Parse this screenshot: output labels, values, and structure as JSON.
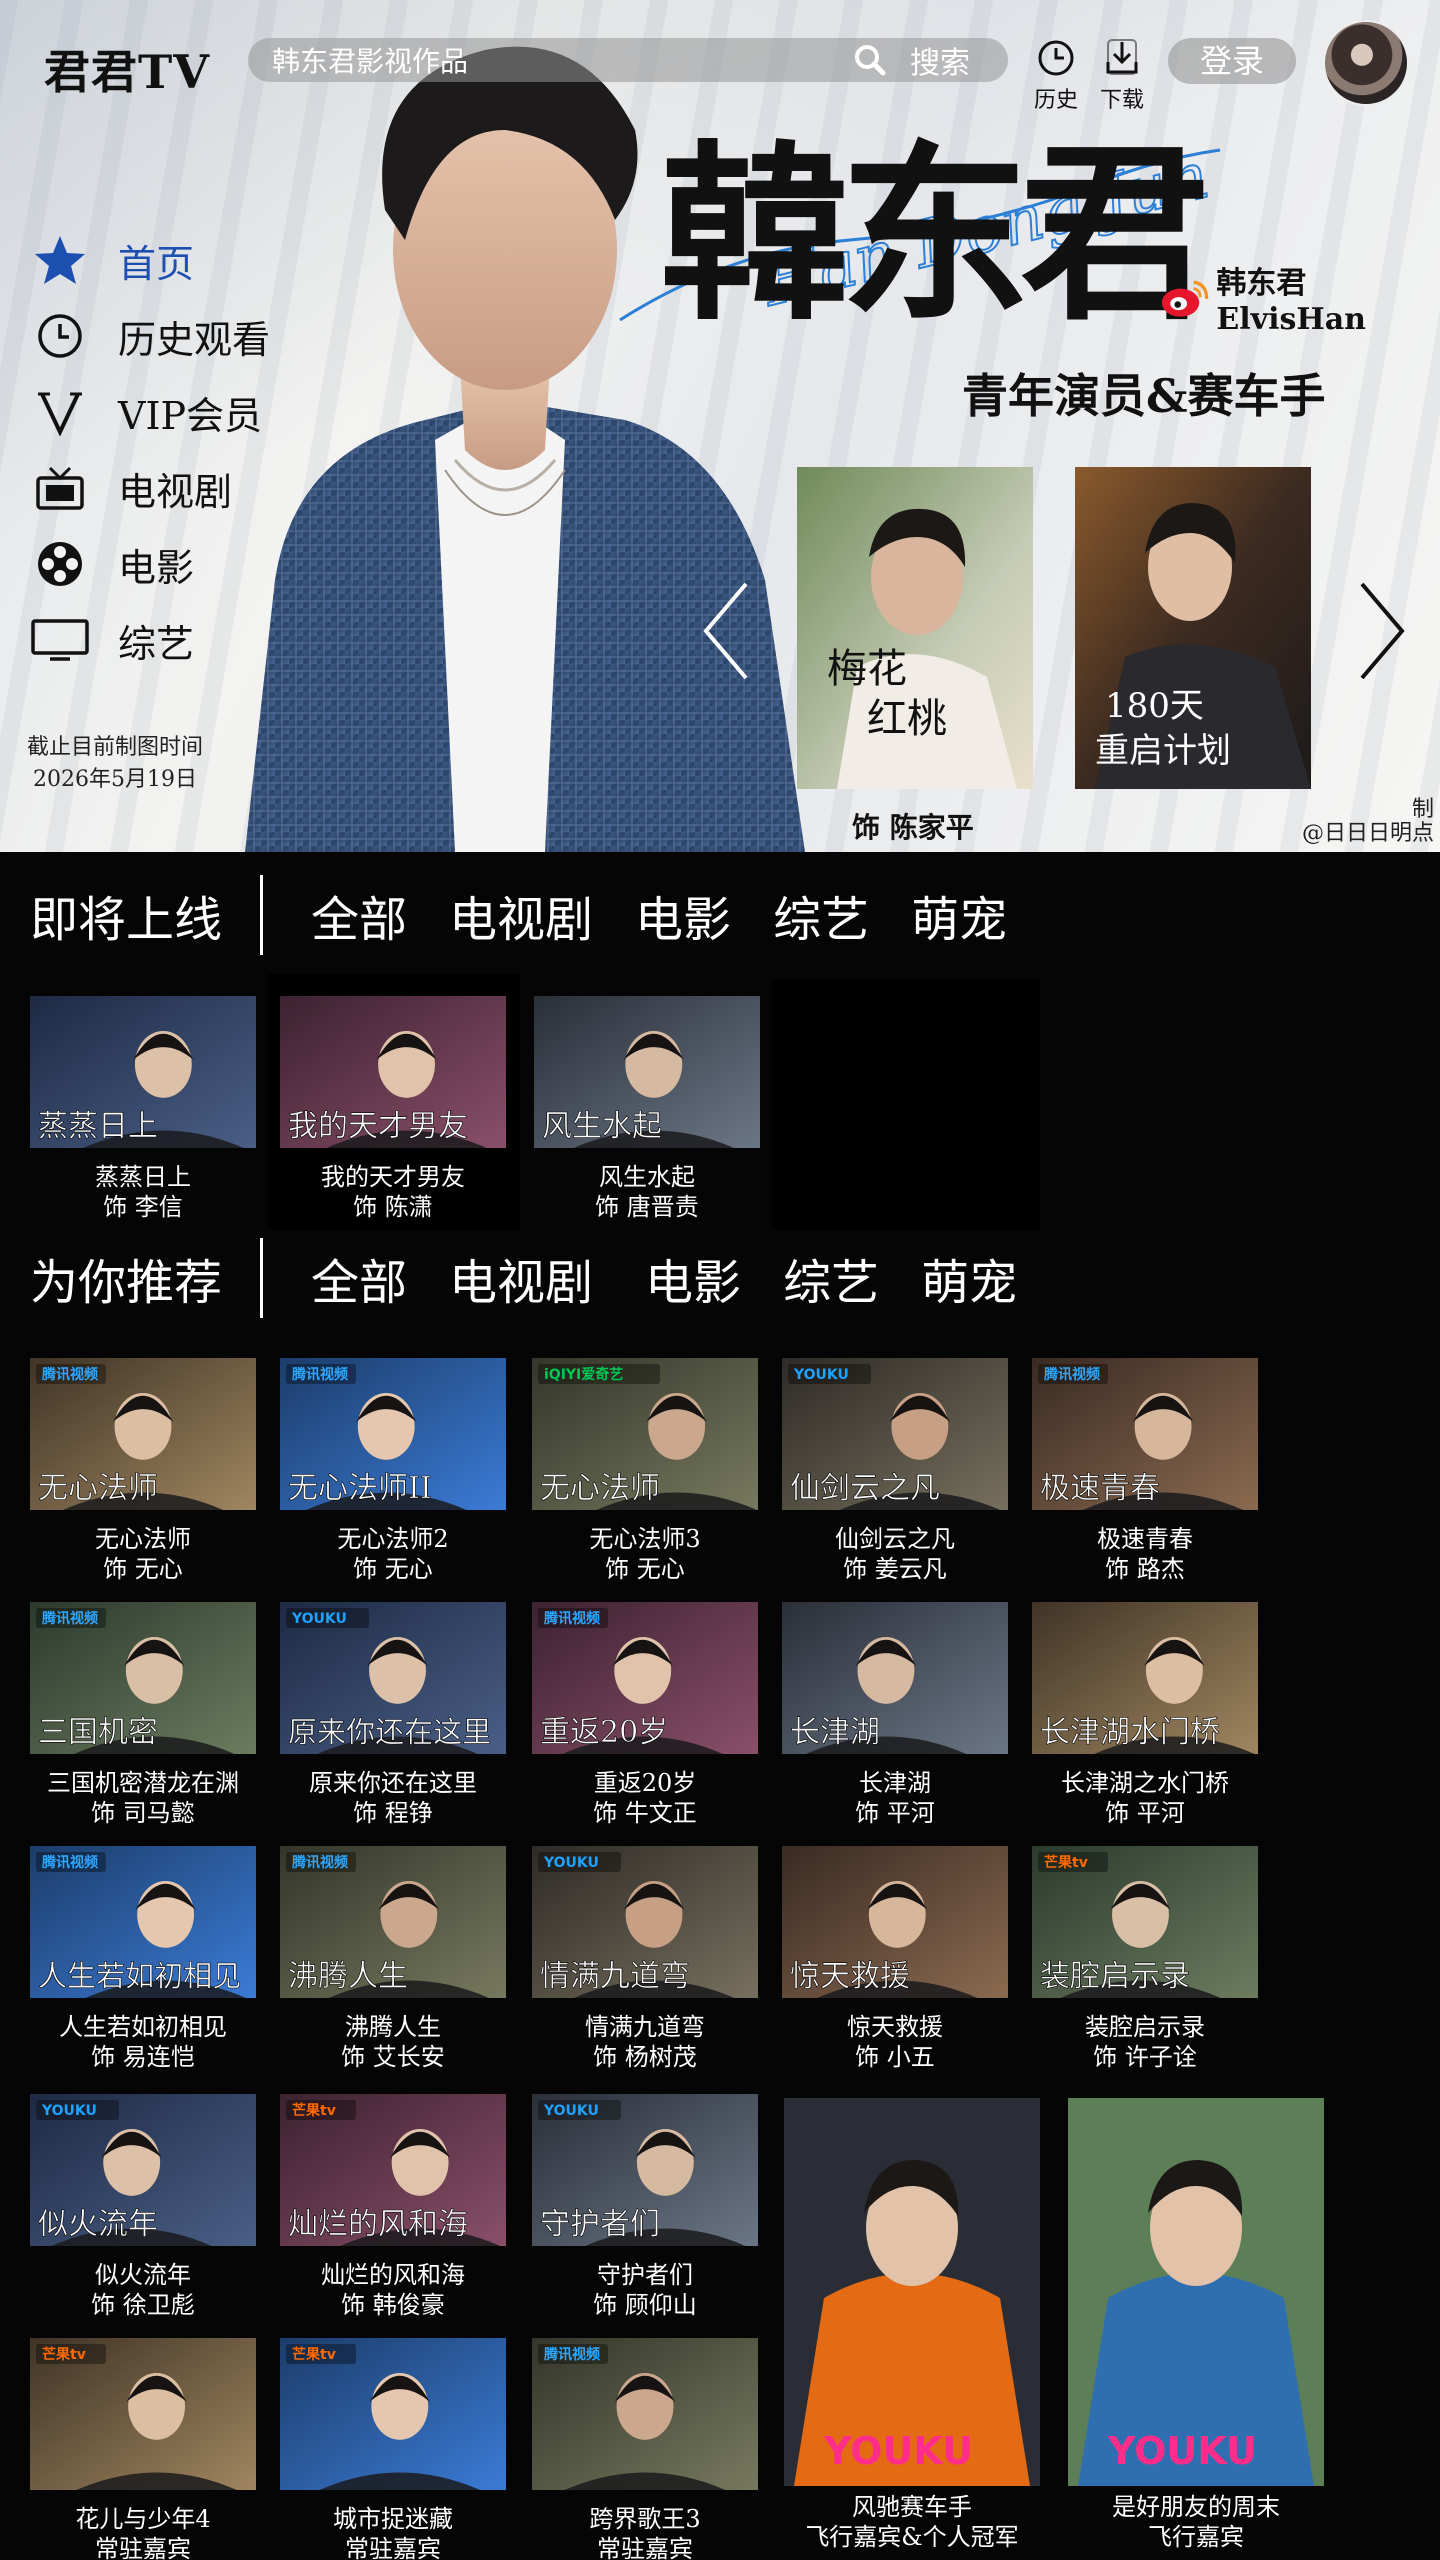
{
  "header": {
    "logo": "君君TV",
    "search_placeholder": "韩东君影视作品",
    "search_button": "搜索",
    "history_label": "历史",
    "download_label": "下载",
    "login_button": "登录"
  },
  "sidebar": {
    "items": [
      {
        "label": "首页",
        "icon": "star-icon"
      },
      {
        "label": "历史观看",
        "icon": "clock-icon"
      },
      {
        "label": "VIP会员",
        "icon": "vip-icon"
      },
      {
        "label": "电视剧",
        "icon": "tv-icon"
      },
      {
        "label": "电影",
        "icon": "film-reel-icon"
      },
      {
        "label": "综艺",
        "icon": "monitor-icon"
      }
    ],
    "as_of_line1": "截止目前制图时间",
    "as_of_line2": "2026年5月19日"
  },
  "hero": {
    "title": "韓东君",
    "script_text": "Han Dong Jun",
    "weibo_name": "韩东君ElvisHan",
    "subtitle": "青年演员&赛车手",
    "posters": [
      {
        "title": "梅花红桃",
        "caption": "饰 陈家平"
      },
      {
        "title": "180天重启计划",
        "caption": ""
      }
    ],
    "weibo_mark_line1": "@日日日明点",
    "weibo_mark_line2": "制"
  },
  "upcoming": {
    "title": "即将上线",
    "tabs": [
      "全部",
      "电视剧",
      "电影",
      "综艺",
      "萌宠"
    ],
    "items": [
      {
        "name": "蒸蒸日上",
        "role": "饰  李信",
        "overlay": "蒸蒸日上"
      },
      {
        "name": "我的天才男友",
        "role": "饰 陈潇",
        "overlay": "我的天才男友"
      },
      {
        "name": "风生水起",
        "role": "饰  唐晋责",
        "overlay": "风生水起"
      }
    ]
  },
  "recommend": {
    "title": "为你推荐",
    "tabs": [
      "全部",
      "电视剧",
      "电影",
      "综艺",
      "萌宠"
    ],
    "rows": [
      [
        {
          "name": "无心法师",
          "role": "饰  无心",
          "platform": "腾讯视频",
          "overlay": "无心法师"
        },
        {
          "name": "无心法师2",
          "role": "饰  无心",
          "platform": "腾讯视频",
          "overlay": "无心法师II"
        },
        {
          "name": "无心法师3",
          "role": "饰  无心",
          "platform": "iQIYI爱奇艺",
          "overlay": "无心法师"
        },
        {
          "name": "仙剑云之凡",
          "role": "饰  姜云凡",
          "platform": "YOUKU",
          "overlay": "仙剑云之凡"
        },
        {
          "name": "极速青春",
          "role": "饰  路杰",
          "platform": "腾讯视频",
          "overlay": "极速青春"
        }
      ],
      [
        {
          "name": "三国机密潜龙在渊",
          "role": "饰  司马懿",
          "platform": "腾讯视频",
          "overlay": "三国机密"
        },
        {
          "name": "原来你还在这里",
          "role": "饰  程铮",
          "platform": "YOUKU",
          "overlay": "原来你还在这里"
        },
        {
          "name": "重返20岁",
          "role": "饰  牛文正",
          "platform": "腾讯视频",
          "overlay": "重返20岁"
        },
        {
          "name": "长津湖",
          "role": "饰  平河",
          "platform": "",
          "overlay": "长津湖"
        },
        {
          "name": "长津湖之水门桥",
          "role": "饰  平河",
          "platform": "",
          "overlay": "长津湖水门桥"
        }
      ],
      [
        {
          "name": "人生若如初相见",
          "role": "饰  易连恺",
          "platform": "腾讯视频",
          "overlay": "人生若如初相见"
        },
        {
          "name": "沸腾人生",
          "role": "饰  艾长安",
          "platform": "腾讯视频",
          "overlay": "沸腾人生"
        },
        {
          "name": "情满九道弯",
          "role": "饰  杨树茂",
          "platform": "YOUKU",
          "overlay": "情满九道弯"
        },
        {
          "name": "惊天救援",
          "role": "饰  小五",
          "platform": "",
          "overlay": "惊天救援"
        },
        {
          "name": "装腔启示录",
          "role": "饰  许子诠",
          "platform": "芒果tv",
          "overlay": "装腔启示录"
        }
      ],
      [
        {
          "name": "似火流年",
          "role": "饰  徐卫彪",
          "platform": "YOUKU",
          "overlay": "似火流年"
        },
        {
          "name": "灿烂的风和海",
          "role": "饰  韩俊豪",
          "platform": "芒果tv",
          "overlay": "灿烂的风和海"
        },
        {
          "name": "守护者们",
          "role": "饰  顾仰山",
          "platform": "YOUKU",
          "overlay": "守护者们"
        }
      ],
      [
        {
          "name": "花儿与少年4",
          "role": "常驻嘉宾",
          "platform": "芒果tv",
          "overlay": ""
        },
        {
          "name": "城市捉迷藏",
          "role": "常驻嘉宾",
          "platform": "芒果tv",
          "overlay": ""
        },
        {
          "name": "跨界歌王3",
          "role": "常驻嘉宾",
          "platform": "腾讯视频",
          "overlay": ""
        }
      ]
    ],
    "tall": [
      {
        "name": "风驰赛车手",
        "role": "飞行嘉宾&个人冠军",
        "platform": "YOUKU"
      },
      {
        "name": "是好朋友的周末",
        "role": "飞行嘉宾",
        "platform": "YOUKU"
      }
    ]
  },
  "colors": {
    "background": "#050505",
    "accent": "#1d4fb0",
    "search_bg": "#969696"
  }
}
